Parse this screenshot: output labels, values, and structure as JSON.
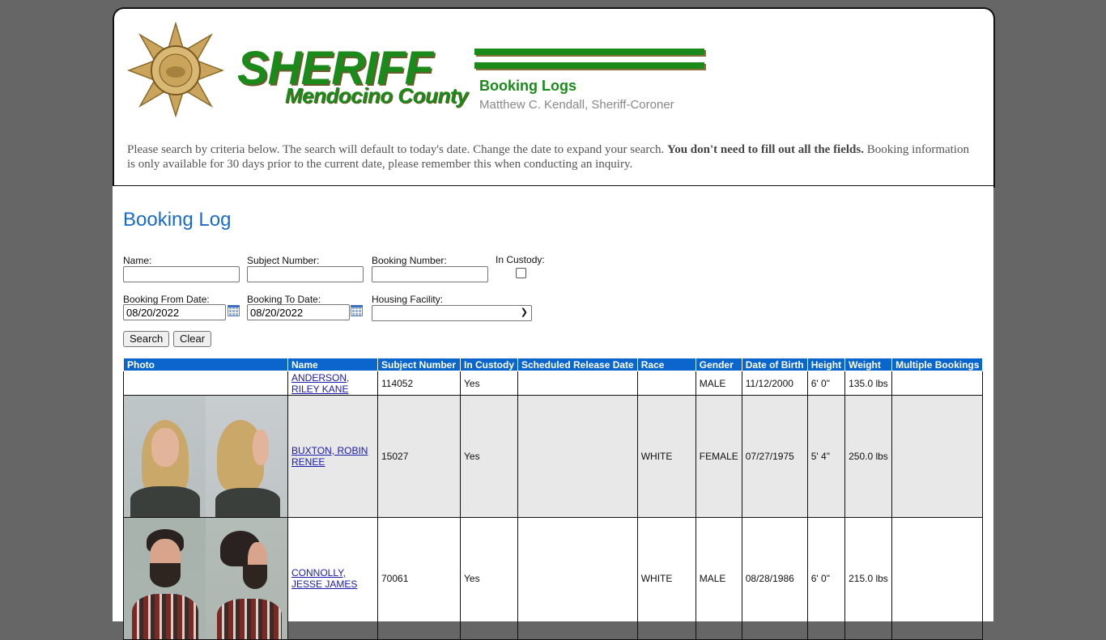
{
  "header": {
    "logo_main": "SHERIFF",
    "logo_county": "Mendocino County",
    "section": "Booking Logs",
    "sheriff_name": "Matthew C. Kendall, Sheriff-Coroner",
    "intro_part1": "Please search by criteria below. The search will default to today's date. Change the date to expand your search. ",
    "intro_bold": "You don't need to fill out all the fields.",
    "intro_part2": " Booking information is only available for 30 days prior to the current date, please remember this when conducting an inquiry."
  },
  "page": {
    "title": "Booking Log"
  },
  "form": {
    "name_label": "Name:",
    "name_value": "",
    "subject_label": "Subject Number:",
    "subject_value": "",
    "booking_label": "Booking Number:",
    "booking_value": "",
    "custody_label": "In Custody:",
    "custody_checked": false,
    "from_label": "Booking From Date:",
    "from_value": "08/20/2022",
    "to_label": "Booking To Date:",
    "to_value": "08/20/2022",
    "facility_label": "Housing Facility:",
    "facility_value": "",
    "search_label": "Search",
    "clear_label": "Clear"
  },
  "table": {
    "headers": [
      "Photo",
      "Name",
      "Subject Number",
      "In Custody",
      "Scheduled Release Date",
      "Race",
      "Gender",
      "Date of Birth",
      "Height",
      "Weight",
      "Multiple Bookings"
    ],
    "rows": [
      {
        "photo": "none",
        "name": "ANDERSON, RILEY KANE",
        "subject": "114052",
        "custody": "Yes",
        "release": "",
        "race": "",
        "gender": "MALE",
        "dob": "11/12/2000",
        "height": "6' 0\"",
        "weight": "135.0 lbs",
        "multiple": ""
      },
      {
        "photo": "mugshot-female",
        "name": "BUXTON, ROBIN RENEE",
        "subject": "15027",
        "custody": "Yes",
        "release": "",
        "race": "WHITE",
        "gender": "FEMALE",
        "dob": "07/27/1975",
        "height": "5' 4\"",
        "weight": "250.0 lbs",
        "multiple": ""
      },
      {
        "photo": "mugshot-male",
        "name": "CONNOLLY, JESSE JAMES",
        "subject": "70061",
        "custody": "Yes",
        "release": "",
        "race": "WHITE",
        "gender": "MALE",
        "dob": "08/28/1986",
        "height": "6' 0\"",
        "weight": "215.0 lbs",
        "multiple": ""
      }
    ]
  }
}
